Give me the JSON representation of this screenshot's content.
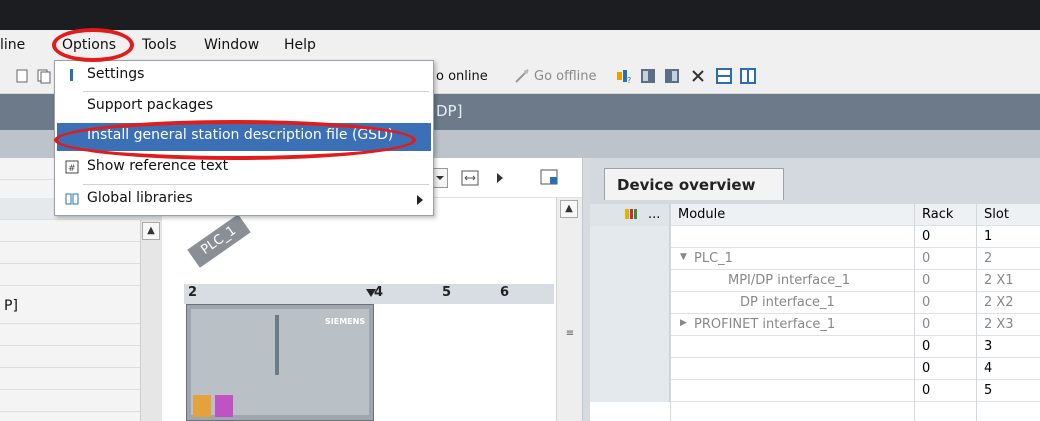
{
  "menubar": {
    "items": [
      "line",
      "Options",
      "Tools",
      "Window",
      "Help"
    ]
  },
  "toolbar": {
    "go_online": "o online",
    "go_offline": "Go offline"
  },
  "header": {
    "title": "DP]"
  },
  "left_panel": {
    "partial_label": "P]"
  },
  "options_menu": {
    "items": [
      {
        "label": "Settings"
      },
      {
        "label": "Support packages"
      },
      {
        "label": "Install general station description file (GSD)"
      },
      {
        "label": "Show reference text"
      },
      {
        "label": "Global libraries"
      }
    ]
  },
  "canvas": {
    "plc_label": "PLC_1",
    "rack_numbers": [
      "2",
      "4",
      "5",
      "6"
    ],
    "brand": "SIEMENS"
  },
  "device_overview": {
    "tab_label": "Device overview",
    "columns": {
      "ellipsis": "...",
      "module": "Module",
      "rack": "Rack",
      "slot": "Slot"
    },
    "rows": [
      {
        "module": "",
        "rack": "0",
        "slot": "1",
        "dim": false
      },
      {
        "module": "PLC_1",
        "rack": "0",
        "slot": "2",
        "dim": true,
        "expander": "down"
      },
      {
        "module": "MPI/DP interface_1",
        "rack": "0",
        "slot": "2 X1",
        "dim": true
      },
      {
        "module": "DP interface_1",
        "rack": "0",
        "slot": "2 X2",
        "dim": true
      },
      {
        "module": "PROFINET interface_1",
        "rack": "0",
        "slot": "2 X3",
        "dim": true,
        "expander": "right"
      },
      {
        "module": "",
        "rack": "0",
        "slot": "3",
        "dim": false
      },
      {
        "module": "",
        "rack": "0",
        "slot": "4",
        "dim": false
      },
      {
        "module": "",
        "rack": "0",
        "slot": "5",
        "dim": false
      }
    ]
  },
  "colors": {
    "highlight": "#3b6fb6",
    "annotation": "#e21b1b",
    "header": "#6c7a8a"
  }
}
